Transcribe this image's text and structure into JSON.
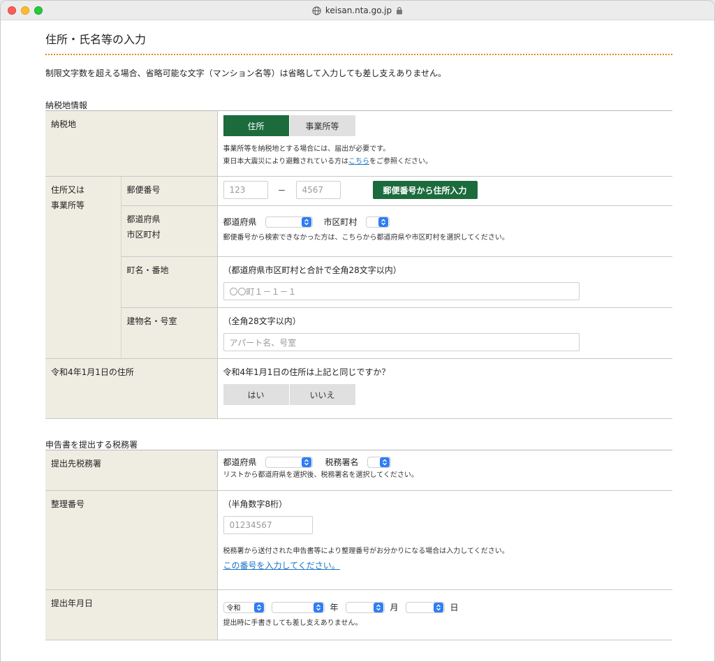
{
  "browser": {
    "url": "keisan.nta.go.jp"
  },
  "page": {
    "title": "住所・氏名等の入力",
    "notice": "制限文字数を超える場合、省略可能な文字（マンション名等）は省略して入力しても差し支えありません。"
  },
  "section1": {
    "label": "納税地情報",
    "nouzeichi": {
      "label": "納税地",
      "options": [
        "住所",
        "事業所等"
      ],
      "note1": "事業所等を納税地とする場合には、届出が必要です。",
      "note2_pre": "東日本大震災により避難されている方は",
      "note2_link": "こちら",
      "note2_post": "をご参照ください。"
    },
    "address_group_label": [
      "住所又は",
      "事業所等"
    ],
    "postal": {
      "label": "郵便番号",
      "placeholder1": "123",
      "dash": "－",
      "placeholder2": "4567",
      "button": "郵便番号から住所入力"
    },
    "prefcity": {
      "label": [
        "都道府県",
        "市区町村"
      ],
      "pref_label": "都道府県",
      "city_label": "市区町村",
      "note": "郵便番号から検索できなかった方は、こちらから都道府県や市区町村を選択してください。"
    },
    "town": {
      "label": "町名・番地",
      "hint": "（都道府県市区町村と合計で全角28文字以内）",
      "placeholder": "〇〇町１－１－１"
    },
    "building": {
      "label": "建物名・号室",
      "hint": "（全角28文字以内）",
      "placeholder": "アパート名、号室"
    },
    "prev_address": {
      "label": "令和4年1月1日の住所",
      "question": "令和4年1月1日の住所は上記と同じですか？",
      "options": [
        "はい",
        "いいえ"
      ]
    }
  },
  "section2": {
    "label": "申告書を提出する税務署",
    "office": {
      "label": "提出先税務署",
      "pref_label": "都道府県",
      "office_label": "税務署名",
      "note": "リストから都道府県を選択後、税務署名を選択してください。"
    },
    "ref_no": {
      "label": "整理番号",
      "hint": "（半角数字8桁）",
      "placeholder": "01234567",
      "note": "税務署から送付された申告書等により整理番号がお分かりになる場合は入力してください。",
      "link": "この番号を入力してください。"
    },
    "date": {
      "label": "提出年月日",
      "era": "令和",
      "year_unit": "年",
      "month_unit": "月",
      "day_unit": "日",
      "note": "提出時に手書きしても差し支えありません。"
    }
  }
}
